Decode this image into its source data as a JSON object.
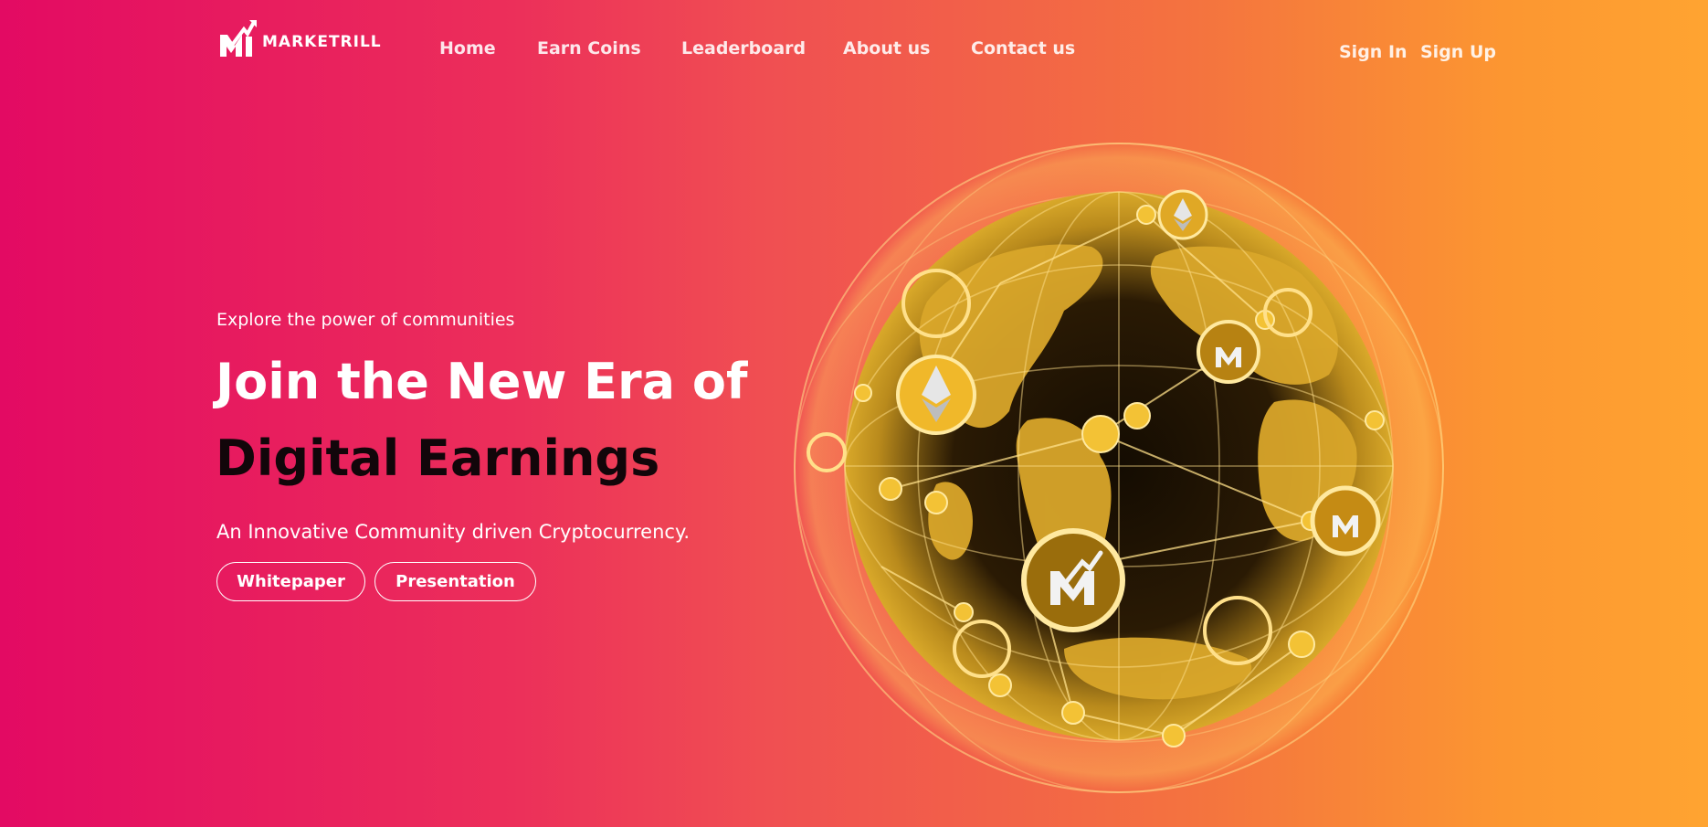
{
  "brand": {
    "name": "MARKETRILL"
  },
  "nav": {
    "items": [
      {
        "label": "Home"
      },
      {
        "label": "Earn Coins"
      },
      {
        "label": "Leaderboard"
      },
      {
        "label": "About us"
      },
      {
        "label": "Contact us"
      }
    ],
    "sign_in": "Sign In",
    "sign_up": "Sign Up"
  },
  "hero": {
    "eyebrow": "Explore the power of communities",
    "headline_line1": "Join the New Era of",
    "headline_line2": "Digital Earnings",
    "subtitle": "An Innovative Community driven Cryptocurrency.",
    "buttons": {
      "whitepaper": "Whitepaper",
      "presentation": "Presentation"
    }
  },
  "colors": {
    "gradient_start": "#e30a63",
    "gradient_end": "#ffa431",
    "globe_gold": "#f3c235",
    "headline_dark": "#12060a"
  },
  "icons": {
    "globe": "crypto-network-globe-illustration",
    "coin_marketrill": "marketrill-coin-icon",
    "coin_ethereum": "ethereum-coin-icon"
  }
}
